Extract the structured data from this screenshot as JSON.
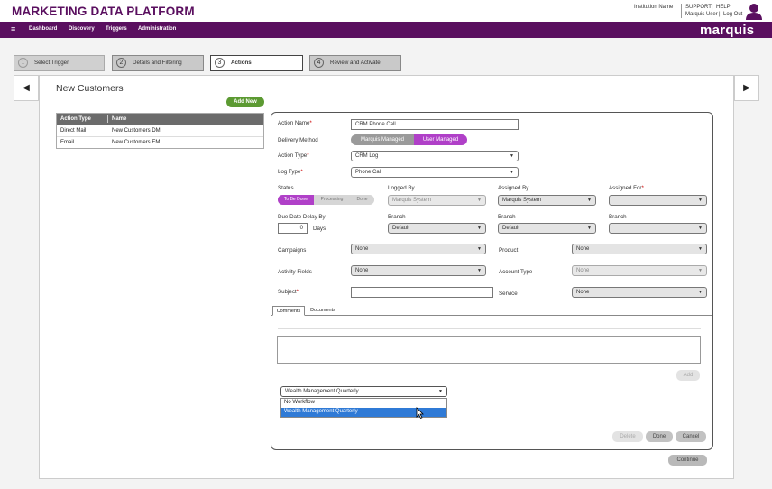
{
  "header": {
    "app_title": "MARKETING DATA PLATFORM",
    "institution": "Institution Name",
    "support": "SUPPORT",
    "help": "HELP",
    "user": "Marquis User",
    "logout": "Log Out",
    "sep1": "|",
    "sep2": "|"
  },
  "nav": {
    "menu_icon": "≡",
    "items": [
      "Dashboard",
      "Discovery",
      "Triggers",
      "Administration"
    ],
    "brand": "marquis"
  },
  "steps": [
    {
      "num": "1",
      "label": "Select Trigger"
    },
    {
      "num": "2",
      "label": "Details and Filtering"
    },
    {
      "num": "3",
      "label": "Actions"
    },
    {
      "num": "4",
      "label": "Review and Activate"
    }
  ],
  "page": {
    "title": "New Customers",
    "add_new": "Add New",
    "prev_arrow": "◀",
    "next_arrow": "▶",
    "continue": "Continue"
  },
  "actions_table": {
    "columns": [
      "Action Type",
      "Name"
    ],
    "rows": [
      [
        "Direct Mail",
        "New Customers DM"
      ],
      [
        "Email",
        "New Customers EM"
      ]
    ]
  },
  "form": {
    "action_name_label": "Action Name",
    "action_name_value": "CRM Phone Call",
    "delivery_method_label": "Delivery Method",
    "delivery_options": [
      "Marquis Managed",
      "User Managed"
    ],
    "action_type_label": "Action Type",
    "action_type_value": "CRM Log",
    "log_type_label": "Log Type",
    "log_type_value": "Phone Call",
    "status_label": "Status",
    "status_options": [
      "To Be Done",
      "Processing",
      "Done"
    ],
    "logged_by_label": "Logged By",
    "logged_by_value": "Marquis System",
    "assigned_by_label": "Assigned By",
    "assigned_by_value": "Marquis System",
    "assigned_for_label": "Assigned For",
    "due_date_label": "Due Date Delay By",
    "due_date_value": "0",
    "days_label": "Days",
    "branch_label": "Branch",
    "branch_logged_value": "Default",
    "branch_assigned_value": "Default",
    "campaigns_label": "Campaigns",
    "campaigns_value": "None",
    "product_label": "Product",
    "product_value": "None",
    "activity_fields_label": "Activity Fields",
    "activity_fields_value": "None",
    "account_type_label": "Account Type",
    "account_type_value": "None",
    "subject_label": "Subject",
    "service_label": "Service",
    "service_value": "None",
    "required_mark": "*",
    "caret": "▼"
  },
  "tabs": [
    "Comments",
    "Documents"
  ],
  "comments": {
    "add": "Add"
  },
  "workflow": {
    "selected": "Wealth Management Quarterly",
    "options": [
      "No Workflow",
      "Wealth Management Quarterly"
    ]
  },
  "panel_buttons": {
    "delete": "Delete",
    "done": "Done",
    "cancel": "Cancel"
  },
  "colors": {
    "brand_purple": "#5a0f5f",
    "toggle_purple": "#b040c8",
    "add_green": "#5c9a32",
    "highlight_blue": "#2f7ad6"
  }
}
